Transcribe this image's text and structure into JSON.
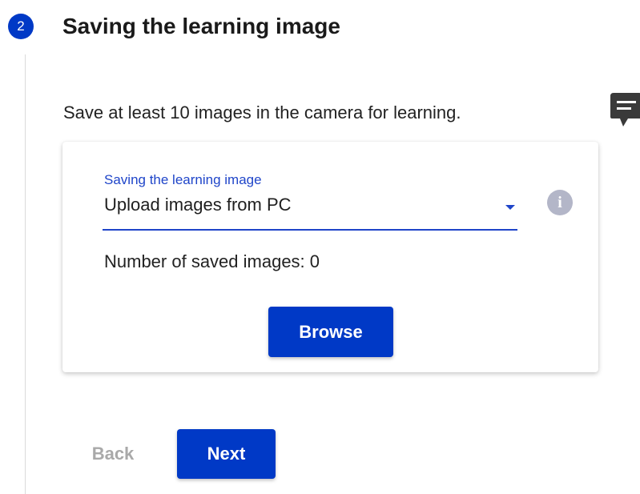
{
  "step": {
    "number": "2",
    "title": "Saving the learning image"
  },
  "instruction": "Save at least 10 images in the camera for learning.",
  "card": {
    "select": {
      "label": "Saving the learning image",
      "value": "Upload images from PC"
    },
    "info_icon": "i",
    "saved_count_text": "Number of saved images: 0",
    "browse_label": "Browse"
  },
  "nav": {
    "back_label": "Back",
    "next_label": "Next"
  },
  "icons": {
    "step": "step-number-icon",
    "info": "info-icon",
    "feedback": "feedback-chat-icon",
    "dropdown": "chevron-down-icon"
  },
  "colors": {
    "primary": "#0039c6",
    "label_blue": "#1f45c9",
    "info_icon": "#b3b6c8",
    "disabled_text": "#a9a9a9",
    "step_line": "#dadada"
  }
}
